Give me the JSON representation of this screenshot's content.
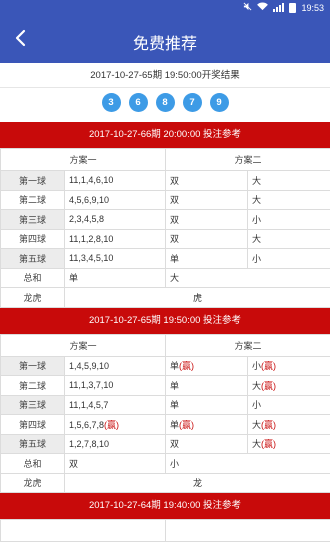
{
  "status_bar": {
    "time": "19:53"
  },
  "header": {
    "title": "免费推荐"
  },
  "draw_result": {
    "label": "2017-10-27-65期 19:50:00开奖结果",
    "balls": [
      "3",
      "6",
      "8",
      "7",
      "9"
    ]
  },
  "sections": [
    {
      "heading": "2017-10-27-66期 20:00:00 投注参考",
      "col1": "方案一",
      "col2": "方案二",
      "rows": [
        {
          "label": "第一球",
          "nums": "11,1,4,6,10",
          "p1": "双",
          "p1win": "",
          "p2": "大",
          "p2win": ""
        },
        {
          "label": "第二球",
          "nums": "4,5,6,9,10",
          "p1": "双",
          "p1win": "",
          "p2": "大",
          "p2win": ""
        },
        {
          "label": "第三球",
          "nums": "2,3,4,5,8",
          "p1": "双",
          "p1win": "",
          "p2": "小",
          "p2win": ""
        },
        {
          "label": "第四球",
          "nums": "11,1,2,8,10",
          "p1": "双",
          "p1win": "",
          "p2": "大",
          "p2win": ""
        },
        {
          "label": "第五球",
          "nums": "11,3,4,5,10",
          "p1": "单",
          "p1win": "",
          "p2": "小",
          "p2win": ""
        }
      ],
      "sum": {
        "label": "总和",
        "v1": "单",
        "v2": "大"
      },
      "longhu": {
        "label": "龙虎",
        "value": "虎"
      }
    },
    {
      "heading": "2017-10-27-65期 19:50:00 投注参考",
      "col1": "方案一",
      "col2": "方案二",
      "rows": [
        {
          "label": "第一球",
          "nums": "1,4,5,9,10",
          "p1": "单",
          "p1win": "(赢)",
          "p2": "小",
          "p2win": "(赢)"
        },
        {
          "label": "第二球",
          "nums": "11,1,3,7,10",
          "p1": "单",
          "p1win": "",
          "p2": "大",
          "p2win": "(赢)"
        },
        {
          "label": "第三球",
          "nums": "11,1,4,5,7",
          "p1": "单",
          "p1win": "",
          "p2": "小",
          "p2win": ""
        },
        {
          "label": "第四球",
          "nums": "1,5,6,7,8",
          "numswin": "(赢)",
          "p1": "单",
          "p1win": "(赢)",
          "p2": "大",
          "p2win": "(赢)"
        },
        {
          "label": "第五球",
          "nums": "1,2,7,8,10",
          "p1": "双",
          "p1win": "",
          "p2": "大",
          "p2win": "(赢)"
        }
      ],
      "sum": {
        "label": "总和",
        "v1": "双",
        "v2": "小"
      },
      "longhu": {
        "label": "龙虎",
        "value": "龙"
      }
    },
    {
      "heading": "2017-10-27-64期 19:40:00 投注参考"
    }
  ]
}
